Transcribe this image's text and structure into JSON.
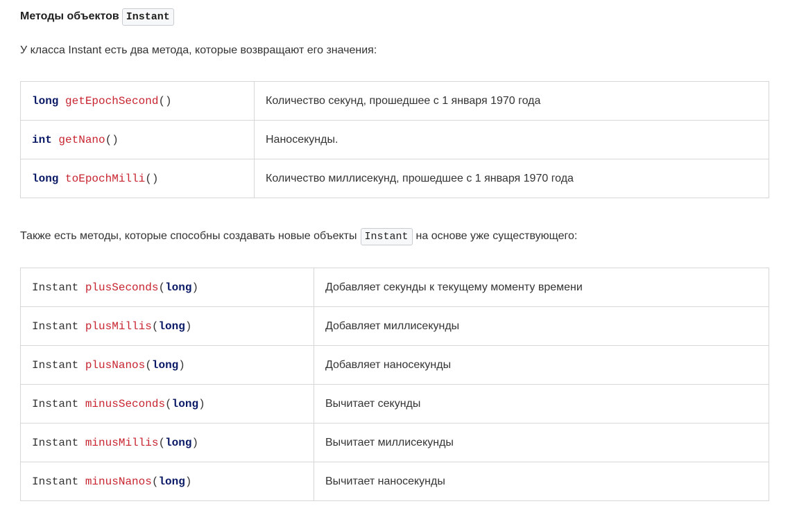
{
  "heading": {
    "text": "Методы объектов",
    "code": "Instant"
  },
  "intro": "У класса Instant есть два метода, которые возвращают его значения:",
  "getter_methods": [
    {
      "return_type": "long",
      "name": "getEpochSecond",
      "params": "()",
      "description": "Количество секунд, прошедшее с 1 января 1970 года"
    },
    {
      "return_type": "int",
      "name": "getNano",
      "params": "()",
      "description": "Наносекунды."
    },
    {
      "return_type": "long",
      "name": "toEpochMilli",
      "params": "()",
      "description": "Количество миллисекунд, прошедшее с 1 января 1970 года"
    }
  ],
  "factory_intro": {
    "before": "Также есть методы, которые способны создавать новые объекты",
    "code": "Instant",
    "after": "на основе уже существующего:"
  },
  "factory_methods": [
    {
      "return_type": "Instant",
      "name": "plusSeconds",
      "open": "(",
      "param": "long",
      "close": ")",
      "description": "Добавляет секунды к текущему моменту времени"
    },
    {
      "return_type": "Instant",
      "name": "plusMillis",
      "open": "(",
      "param": "long",
      "close": ")",
      "description": "Добавляет миллисекунды"
    },
    {
      "return_type": "Instant",
      "name": "plusNanos",
      "open": "(",
      "param": "long",
      "close": ")",
      "description": "Добавляет наносекунды"
    },
    {
      "return_type": "Instant",
      "name": "minusSeconds",
      "open": "(",
      "param": "long",
      "close": ")",
      "description": "Вычитает секунды"
    },
    {
      "return_type": "Instant",
      "name": "minusMillis",
      "open": "(",
      "param": "long",
      "close": ")",
      "description": "Вычитает миллисекунды"
    },
    {
      "return_type": "Instant",
      "name": "minusNanos",
      "open": "(",
      "param": "long",
      "close": ")",
      "description": "Вычитает наносекунды"
    }
  ],
  "colors": {
    "keyword": "#0b1a66",
    "method_name": "#c8242f",
    "border": "#d6d6d6"
  }
}
